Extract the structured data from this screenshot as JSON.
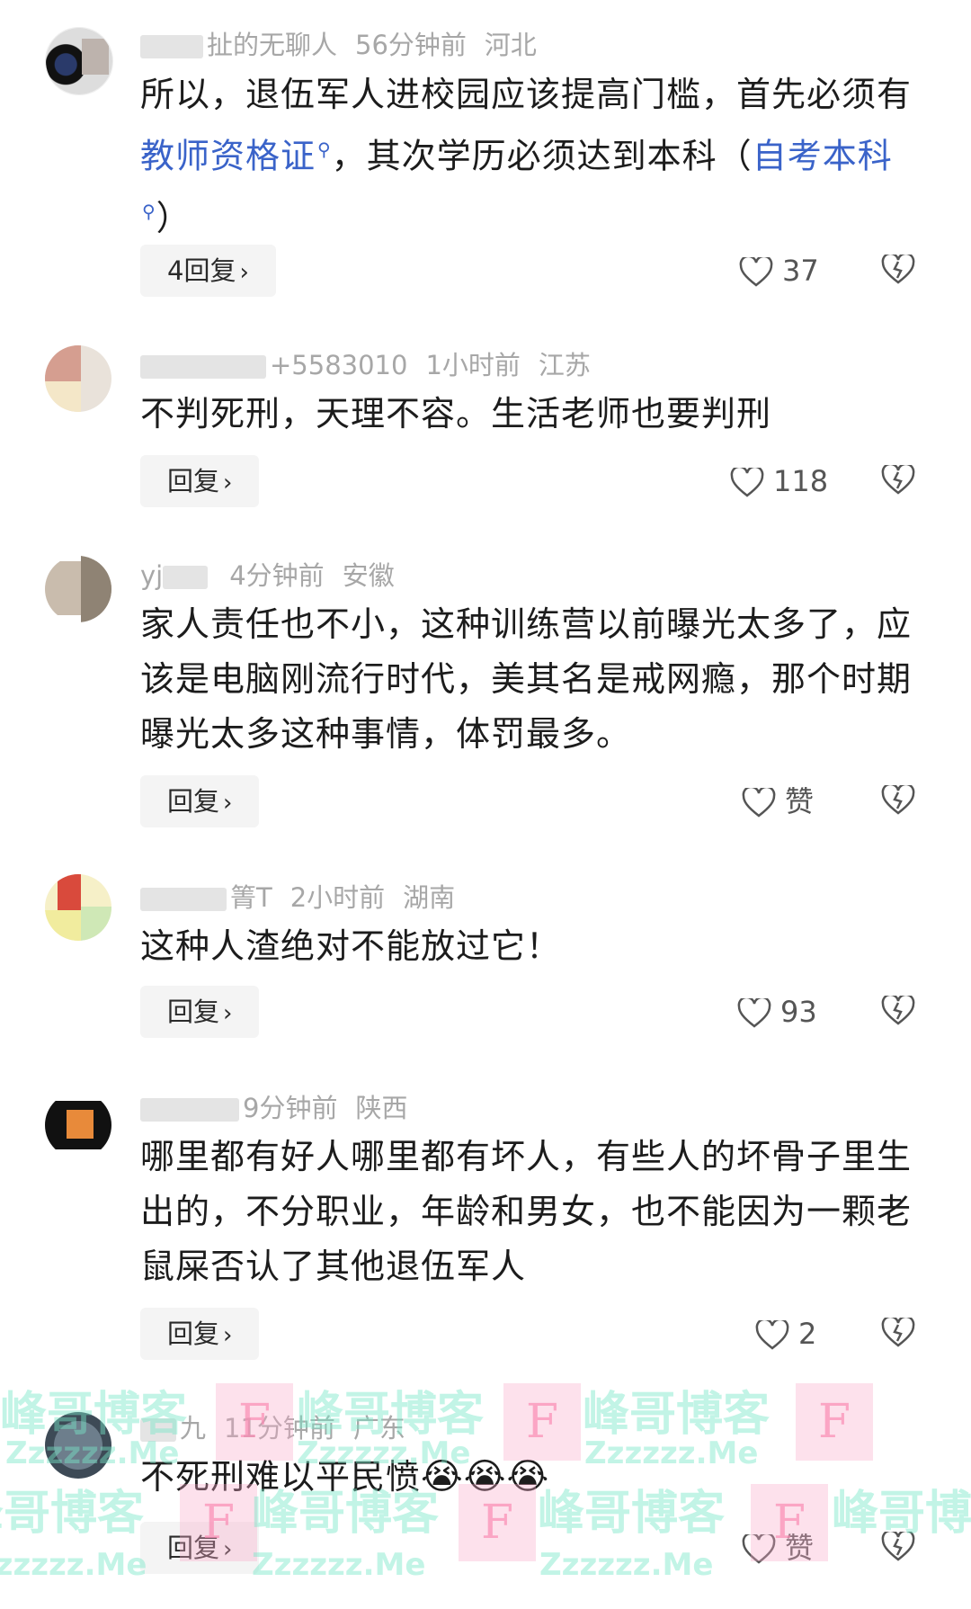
{
  "comments": [
    {
      "username": "扯的无聊人",
      "time": "56分钟前",
      "location": "河北",
      "text_parts": [
        "所以，退伍军人进校园应该提高门槛，首先必须有",
        "教师资格证",
        "，其次学历必须达到本科（",
        "自考本科",
        "）"
      ],
      "reply_label": "4回复",
      "like_count": "37"
    },
    {
      "username": "+5583010",
      "time": "1小时前",
      "location": "江苏",
      "text": "不判死刑，天理不容。生活老师也要判刑",
      "reply_label": "回复",
      "like_count": "118"
    },
    {
      "username": "yj",
      "time": "4分钟前",
      "location": "安徽",
      "text": "家人责任也不小，这种训练营以前曝光太多了，应该是电脑刚流行时代，美其名是戒网瘾，那个时期曝光太多这种事情，体罚最多。",
      "reply_label": "回复",
      "like_count": "赞"
    },
    {
      "username": "箐T",
      "time": "2小时前",
      "location": "湖南",
      "text": "这种人渣绝对不能放过它！",
      "reply_label": "回复",
      "like_count": "93"
    },
    {
      "username": "",
      "time": "9分钟前",
      "location": "陕西",
      "text": "哪里都有好人哪里都有坏人，有些人的坏骨子里生出的，不分职业，年龄和男女，也不能因为一颗老鼠屎否认了其他退伍军人",
      "reply_label": "回复",
      "like_count": "2"
    },
    {
      "username": "九",
      "time": "11分钟前",
      "location": "广东",
      "text": "不死刑难以平民愤",
      "emoji": "😭😭😭",
      "reply_label": "回复",
      "like_count": "赞"
    }
  ],
  "watermark": {
    "name": "峰哥博客",
    "domain": "Zzzzzz.Me",
    "logo_letter": "F"
  },
  "icons": {
    "search_mark": "magnifier-icon",
    "like": "heart-outline-icon",
    "dislike": "broken-heart-icon",
    "chevron": "chevron-right-icon"
  }
}
